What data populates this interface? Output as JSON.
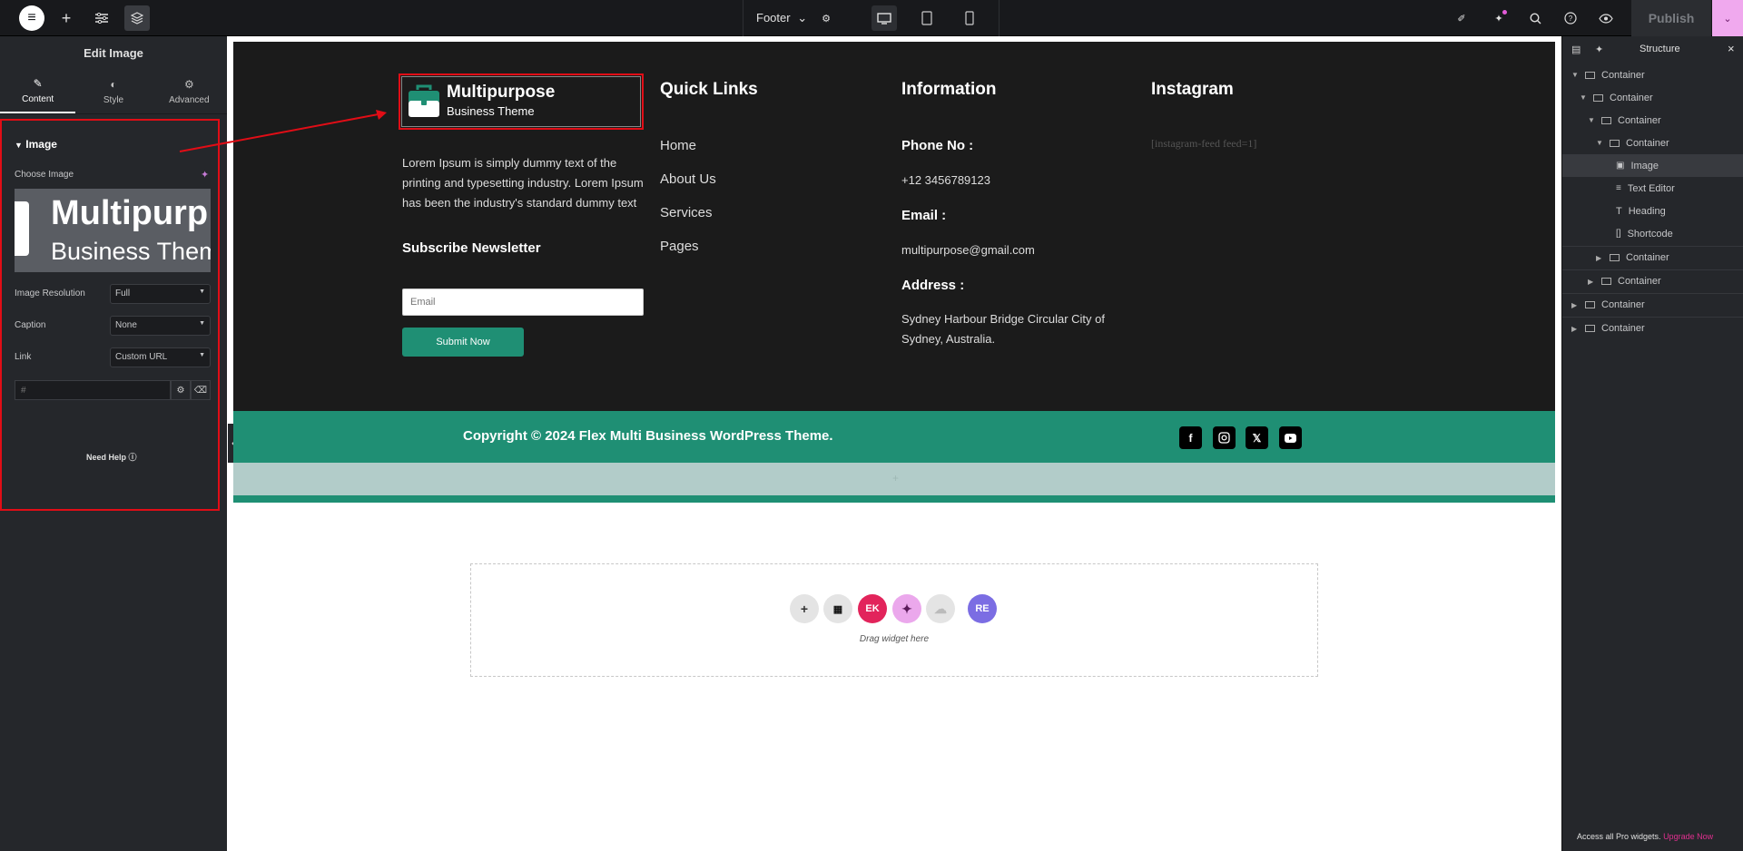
{
  "topbar": {
    "footer_label": "Footer",
    "publish_label": "Publish"
  },
  "left_panel": {
    "title": "Edit Image",
    "tabs": [
      {
        "label": "Content",
        "icon": "pencil-icon"
      },
      {
        "label": "Style",
        "icon": "contrast-icon"
      },
      {
        "label": "Advanced",
        "icon": "gear-icon"
      }
    ],
    "section_title": "Image",
    "choose_image_label": "Choose Image",
    "thumb": {
      "line1": "Multipurp",
      "line2": "Business Theme"
    },
    "resolution": {
      "label": "Image Resolution",
      "value": "Full"
    },
    "caption": {
      "label": "Caption",
      "value": "None"
    },
    "link": {
      "label": "Link",
      "value": "Custom URL"
    },
    "url": {
      "placeholder": "#"
    },
    "help_label": "Need Help"
  },
  "site_footer": {
    "logo": {
      "title": "Multipurpose",
      "subtitle": "Business Theme"
    },
    "about_text": "Lorem Ipsum is simply dummy text of the printing and typesetting industry. Lorem Ipsum has been the industry's standard dummy text",
    "subscribe_title": "Subscribe Newsletter",
    "email_placeholder": "Email",
    "submit_label": "Submit Now",
    "quick_links": {
      "title": "Quick Links",
      "items": [
        "Home",
        "About Us",
        "Services",
        "Pages"
      ]
    },
    "information": {
      "title": "Information",
      "phone_label": "Phone No :",
      "phone": "+12 3456789123",
      "email_label": "Email :",
      "email": "multipurpose@gmail.com",
      "address_label": "Address :",
      "address": "Sydney Harbour Bridge Circular City of Sydney, Australia."
    },
    "instagram": {
      "title": "Instagram",
      "shortcode": "[instagram-feed feed=1]"
    },
    "copyright": "Copyright © 2024 Flex Multi Business WordPress Theme."
  },
  "dropzone": {
    "label": "Drag widget here"
  },
  "structure": {
    "title": "Structure",
    "items": [
      {
        "label": "Container"
      },
      {
        "label": "Container"
      },
      {
        "label": "Container"
      },
      {
        "label": "Container"
      },
      {
        "label": "Image"
      },
      {
        "label": "Text Editor"
      },
      {
        "label": "Heading"
      },
      {
        "label": "Shortcode"
      },
      {
        "label": "Container"
      },
      {
        "label": "Container"
      },
      {
        "label": "Container"
      },
      {
        "label": "Container"
      }
    ],
    "promo_text": "Access all Pro widgets.",
    "promo_link": "Upgrade Now"
  },
  "colors": {
    "accent_green": "#1f8f74",
    "highlight_red": "#e10d16",
    "upgrade_pink": "#e02f8f"
  }
}
